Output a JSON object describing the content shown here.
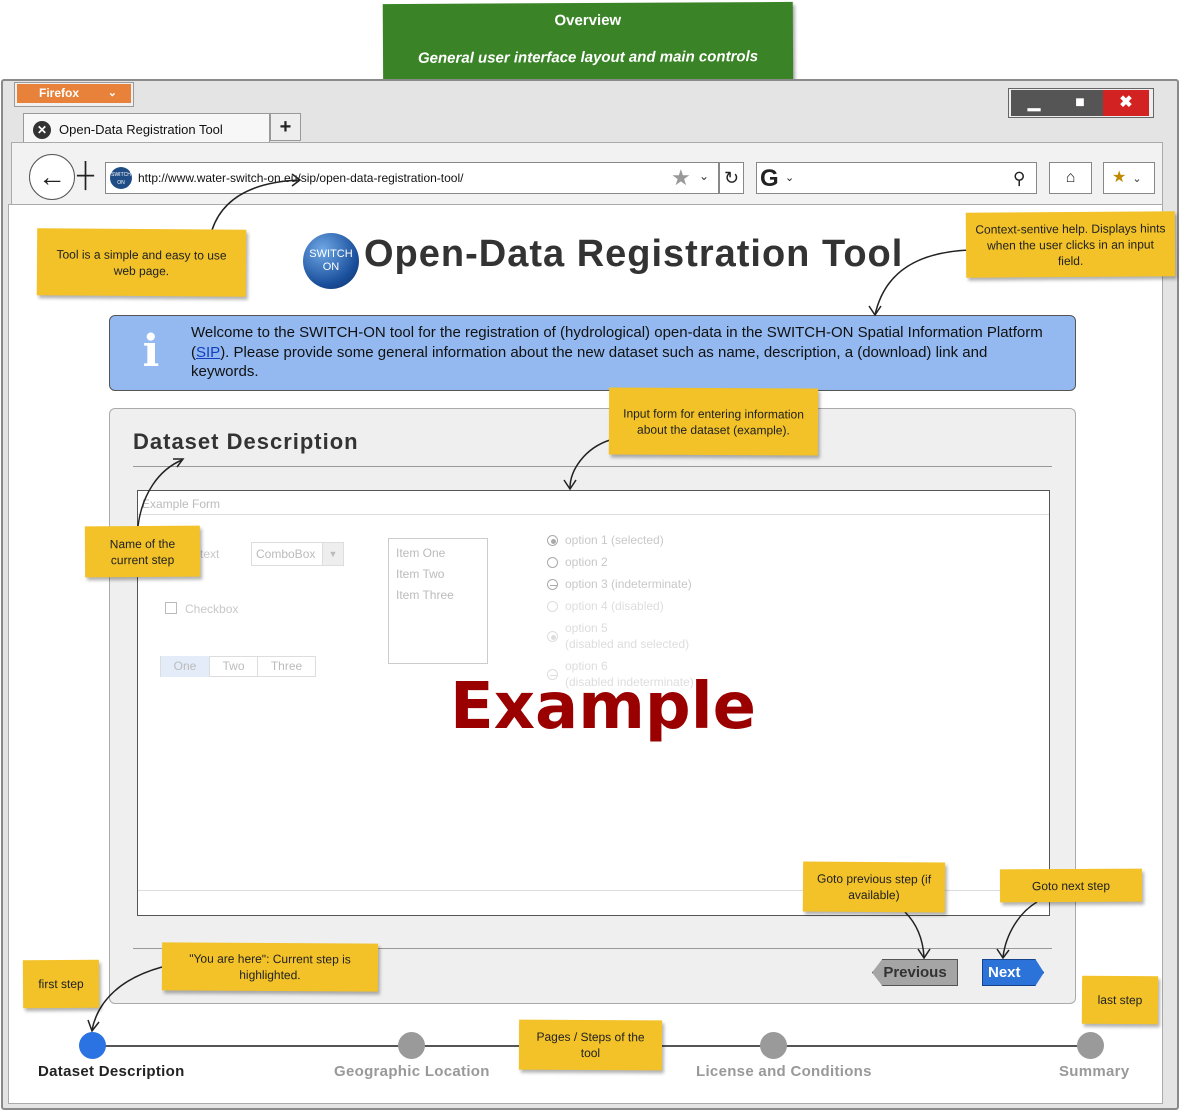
{
  "overview": {
    "title": "Overview",
    "subtitle": "General user interface layout and main controls"
  },
  "browser": {
    "menu_label": "Firefox",
    "window_controls": [
      "▁",
      "■",
      "✖"
    ],
    "tab_title": "Open-Data Registration Tool",
    "new_tab_label": "+",
    "url": "http://www.water-switch-on.eu/sip/open-data-registration-tool/",
    "search_engine_label": "G"
  },
  "page": {
    "logo_text": "SWITCH ON",
    "title": "Open-Data Registration Tool",
    "info": {
      "text_before": "Welcome to the SWITCH-ON tool for the registration of (hydrological) open-data in the SWITCH-ON Spatial Information Platform (",
      "link": "SIP",
      "text_after": "). Please provide some general information about the new dataset such as name, description, a (download) link and keywords."
    },
    "panel_title": "Dataset Description",
    "form": {
      "header": "Example Form",
      "text_label": "text",
      "combo_value": "ComboBox",
      "checkbox_label": "Checkbox",
      "segments": [
        "One",
        "Two",
        "Three"
      ],
      "list_items": [
        "Item One",
        "Item Two",
        "Item Three"
      ],
      "radio_options": [
        {
          "label": "option 1 (selected)",
          "state": "selected"
        },
        {
          "label": "option 2",
          "state": "normal"
        },
        {
          "label": "option 3 (indeterminate)",
          "state": "indeterminate"
        },
        {
          "label": "option 4 (disabled)",
          "state": "disabled"
        },
        {
          "label": "option 5",
          "sub": "(disabled and selected)",
          "state": "disabled-selected"
        },
        {
          "label": "option 6",
          "sub": "(disabled indeterminate)",
          "state": "disabled-indeterminate"
        }
      ],
      "watermark": "Example"
    },
    "previous_label": "Previous",
    "next_label": "Next"
  },
  "steps": [
    {
      "label": "Dataset Description",
      "active": true
    },
    {
      "label": "Geographic Location",
      "active": false
    },
    {
      "label": "License and Conditions",
      "active": false
    },
    {
      "label": "Summary",
      "active": false
    }
  ],
  "notes": {
    "simple": "Tool is a simple and easy to use web page.",
    "context_help": "Context-sentive help. Displays hints when the user clicks in an input field.",
    "input_form": "Input form for entering information about the dataset (example).",
    "current_step": "Name of the current step",
    "goto_prev": "Goto previous step (if available)",
    "goto_next": "Goto next step",
    "you_are_here": "\"You are here\": Current step is highlighted.",
    "first_step": "first step",
    "pages_steps": "Pages / Steps of the tool",
    "last_step": "last step"
  },
  "colors": {
    "overview": "#3a8427",
    "note": "#f2c228",
    "info": "#93b9f0",
    "accent": "#2b73e3",
    "example": "#9b0000"
  }
}
